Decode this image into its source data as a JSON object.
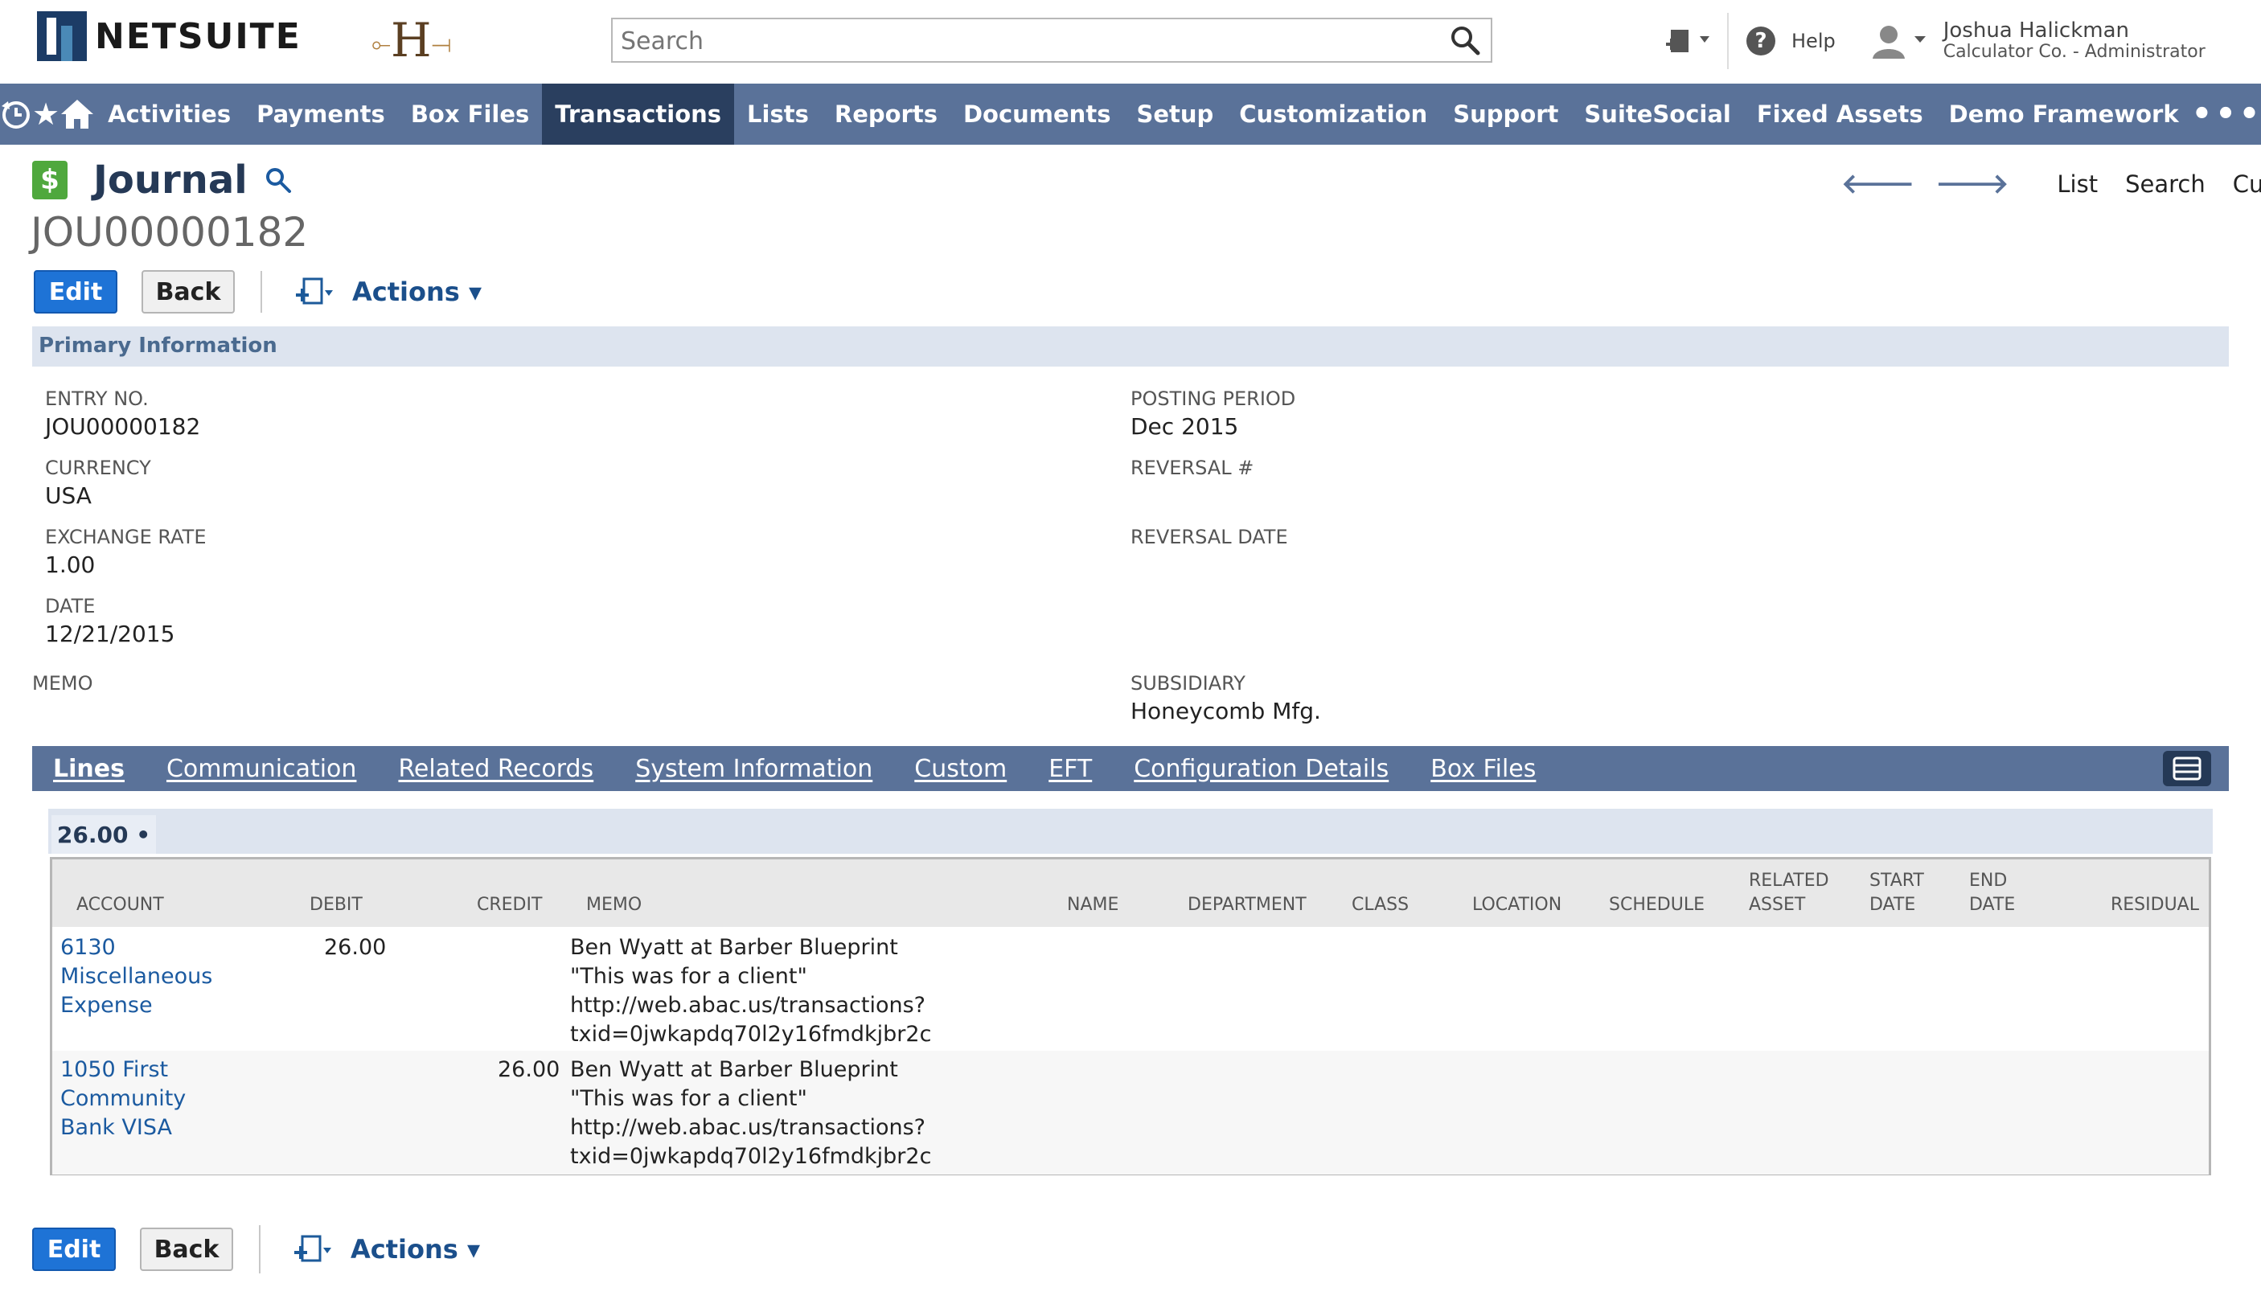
{
  "header": {
    "brand": "NETSUITE",
    "company_logo": "H",
    "search_placeholder": "Search",
    "help_label": "Help",
    "user_name": "Joshua Halickman",
    "user_role": "Calculator Co. - Administrator"
  },
  "nav": {
    "icons": [
      "recent-icon",
      "star-icon",
      "home-icon"
    ],
    "items": [
      "Activities",
      "Payments",
      "Box Files",
      "Transactions",
      "Lists",
      "Reports",
      "Documents",
      "Setup",
      "Customization",
      "Support",
      "SuiteSocial",
      "Fixed Assets",
      "Demo Framework"
    ],
    "active": "Transactions",
    "more_label": "•••"
  },
  "page": {
    "title": "Journal",
    "record_id": "JOU00000182",
    "topnav": [
      "List",
      "Search",
      "Customize"
    ]
  },
  "toolbar": {
    "edit_label": "Edit",
    "back_label": "Back",
    "actions_label": "Actions ▾"
  },
  "primary": {
    "section_title": "Primary Information",
    "entry_no_label": "ENTRY NO.",
    "entry_no": "JOU00000182",
    "currency_label": "CURRENCY",
    "currency": "USA",
    "exchange_rate_label": "EXCHANGE RATE",
    "exchange_rate": "1.00",
    "date_label": "DATE",
    "date": "12/21/2015",
    "memo_label": "MEMO",
    "posting_period_label": "POSTING PERIOD",
    "posting_period": "Dec 2015",
    "reversal_label": "REVERSAL #",
    "reversal_date_label": "REVERSAL DATE",
    "subsidiary_label": "SUBSIDIARY",
    "subsidiary": "Honeycomb Mfg."
  },
  "tabs": [
    "Lines",
    "Communication",
    "Related Records",
    "System Information",
    "Custom",
    "EFT",
    "Configuration Details",
    "Box Files"
  ],
  "active_tab": "Lines",
  "lines": {
    "total": "26.00 •",
    "columns": [
      "ACCOUNT",
      "DEBIT",
      "CREDIT",
      "MEMO",
      "NAME",
      "DEPARTMENT",
      "CLASS",
      "LOCATION",
      "SCHEDULE",
      "RELATED ASSET",
      "START DATE",
      "END DATE",
      "RESIDUAL"
    ],
    "rows": [
      {
        "account": [
          "6130",
          "Miscellaneous",
          "Expense"
        ],
        "debit": "26.00",
        "credit": "",
        "memo": [
          "Ben Wyatt at Barber Blueprint",
          "\"This was for a client\"",
          "http://web.abac.us/transactions?",
          "txid=0jwkapdq70l2y16fmdkjbr2c"
        ]
      },
      {
        "account": [
          "1050 First",
          "Community",
          "Bank VISA"
        ],
        "debit": "",
        "credit": "26.00",
        "memo": [
          "Ben Wyatt at Barber Blueprint",
          "\"This was for a client\"",
          "http://web.abac.us/transactions?",
          "txid=0jwkapdq70l2y16fmdkjbr2c"
        ]
      }
    ]
  },
  "colors": {
    "nav_bg": "#5a7299",
    "nav_active": "#2a3f5f",
    "section_bg": "#dde4ef",
    "edit_blue": "#1e73d6",
    "link_blue": "#1b5aa0"
  }
}
